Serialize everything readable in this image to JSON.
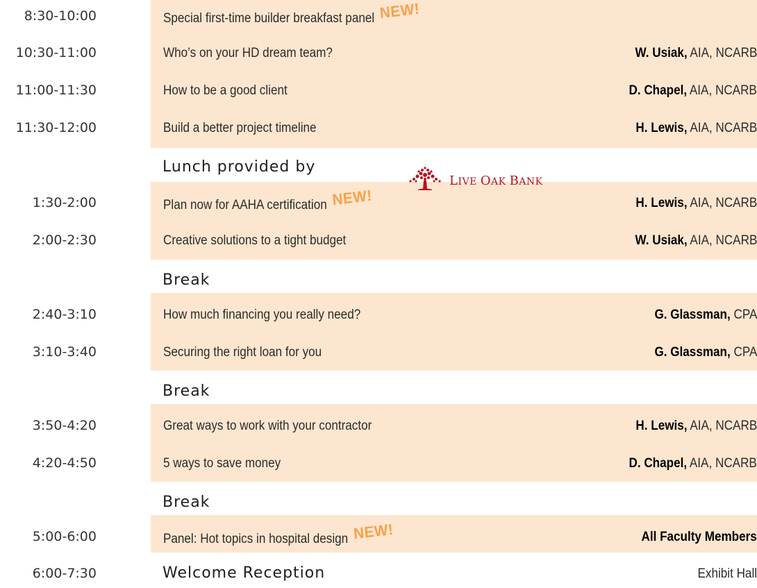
{
  "new_badge": "NEW!",
  "sessions": [
    {
      "time": "8:30-10:00",
      "topic": "Special first-time builder breakfast panel",
      "name": "",
      "cred": ""
    },
    {
      "time": "10:30-11:00",
      "topic": "Who’s on your HD dream team?",
      "name": "W. Usiak,",
      "cred": " AIA, NCARB"
    },
    {
      "time": "11:00-11:30",
      "topic": "How to be a good client",
      "name": "D. Chapel,",
      "cred": " AIA, NCARB"
    },
    {
      "time": "11:30-12:00",
      "topic": "Build a better project timeline",
      "name": "H. Lewis,",
      "cred": " AIA, NCARB"
    },
    {
      "time": "1:30-2:00",
      "topic": "Plan now for AAHA certification",
      "name": "H. Lewis,",
      "cred": " AIA, NCARB"
    },
    {
      "time": "2:00-2:30",
      "topic": "Creative solutions to a tight budget",
      "name": "W. Usiak,",
      "cred": " AIA, NCARB"
    },
    {
      "time": "2:40-3:10",
      "topic": "How much financing you really need?",
      "name": "G. Glassman,",
      "cred": " CPA"
    },
    {
      "time": "3:10-3:40",
      "topic": "Securing the right loan for you",
      "name": "G. Glassman,",
      "cred": " CPA"
    },
    {
      "time": "3:50-4:20",
      "topic": "Great ways to work with your contractor",
      "name": "H. Lewis,",
      "cred": " AIA, NCARB"
    },
    {
      "time": "4:20-4:50",
      "topic": "5 ways to save money",
      "name": "D. Chapel,",
      "cred": " AIA, NCARB"
    },
    {
      "time": "5:00-6:00",
      "topic": "Panel: Hot topics in hospital design",
      "name": "All Faculty Members",
      "cred": ""
    }
  ],
  "lunch": {
    "label": "Lunch provided by",
    "logo_word_1_initial": "L",
    "logo_word_1_rest": "IVE ",
    "logo_word_2_initial": "O",
    "logo_word_2_rest": "AK ",
    "logo_word_3_initial": "B",
    "logo_word_3_rest": "ANK",
    "logo_color": "#b3161f"
  },
  "break_label": "Break",
  "reception": {
    "time": "6:00-7:30",
    "title": "Welcome Reception",
    "location": "Exhibit Hall"
  },
  "colors": {
    "shade": "#fde6cf",
    "new_badge": "#f7a24a"
  }
}
